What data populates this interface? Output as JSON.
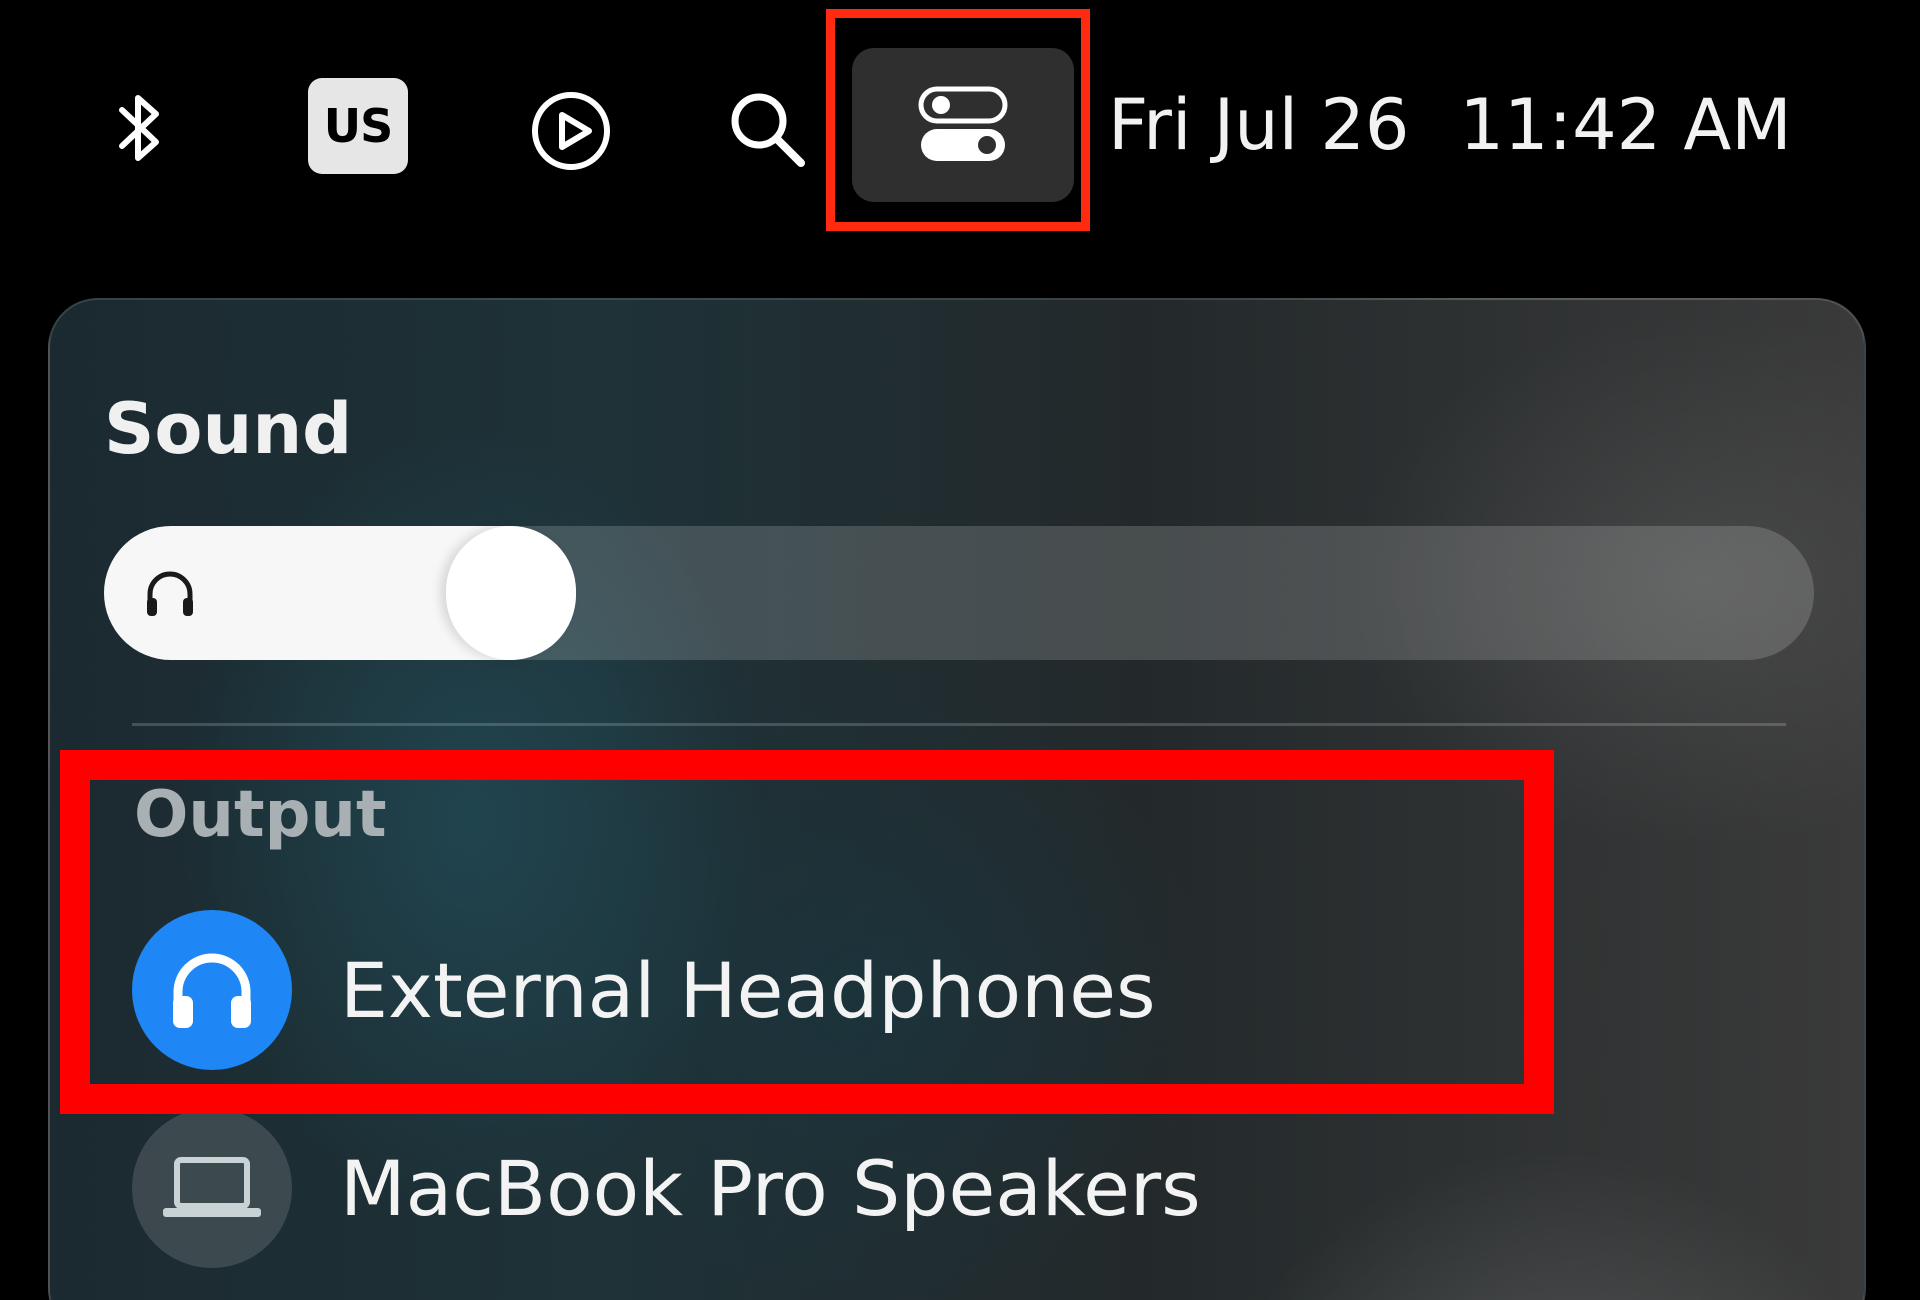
{
  "menubar": {
    "icons": {
      "bluetooth": "bluetooth-icon",
      "input_source": "keyboard-input-source",
      "now_playing": "play-circle-icon",
      "search": "search-icon",
      "control_center": "control-center-toggles-icon"
    },
    "input_source_label": "US",
    "date": "Fri Jul 26",
    "time": "11:42 AM"
  },
  "sound_panel": {
    "title": "Sound",
    "volume": {
      "level_fraction": 0.2,
      "icon": "headphones-icon"
    },
    "output_section": {
      "label": "Output",
      "devices": [
        {
          "label": "External Headphones",
          "icon": "headphones-icon",
          "selected": true
        },
        {
          "label": "MacBook Pro Speakers",
          "icon": "laptop-icon",
          "selected": false
        }
      ]
    }
  },
  "colors": {
    "highlight": "#ff0000",
    "accent_blue": "#1e87f5",
    "menubar_bg": "#000000"
  }
}
